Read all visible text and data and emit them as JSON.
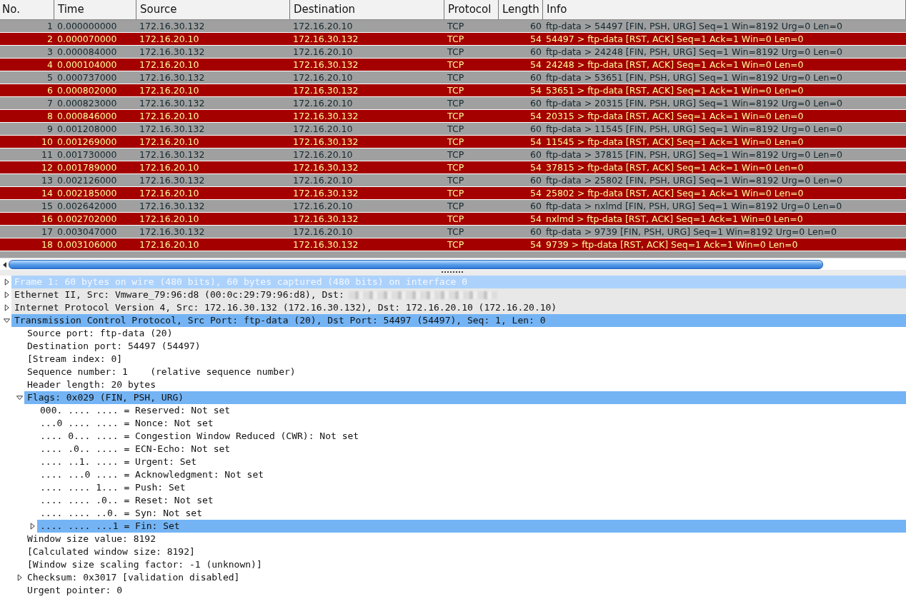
{
  "packet_list": {
    "columns": [
      "No.",
      "Time",
      "Source",
      "Destination",
      "Protocol",
      "Length",
      "Info"
    ],
    "rows": [
      {
        "kind": "normal",
        "cells": [
          "1",
          "0.000000000",
          "172.16.30.132",
          "172.16.20.10",
          "TCP",
          "60",
          "ftp-data > 54497 [FIN, PSH, URG] Seq=1 Win=8192 Urg=0 Len=0"
        ]
      },
      {
        "kind": "alert",
        "cells": [
          "2",
          "0.000070000",
          "172.16.20.10",
          "172.16.30.132",
          "TCP",
          "54",
          "54497 > ftp-data [RST, ACK] Seq=1 Ack=1 Win=0 Len=0"
        ]
      },
      {
        "kind": "normal",
        "cells": [
          "3",
          "0.000084000",
          "172.16.30.132",
          "172.16.20.10",
          "TCP",
          "60",
          "ftp-data > 24248 [FIN, PSH, URG] Seq=1 Win=8192 Urg=0 Len=0"
        ]
      },
      {
        "kind": "alert",
        "cells": [
          "4",
          "0.000104000",
          "172.16.20.10",
          "172.16.30.132",
          "TCP",
          "54",
          "24248 > ftp-data [RST, ACK] Seq=1 Ack=1 Win=0 Len=0"
        ]
      },
      {
        "kind": "normal",
        "cells": [
          "5",
          "0.000737000",
          "172.16.30.132",
          "172.16.20.10",
          "TCP",
          "60",
          "ftp-data > 53651 [FIN, PSH, URG] Seq=1 Win=8192 Urg=0 Len=0"
        ]
      },
      {
        "kind": "alert",
        "cells": [
          "6",
          "0.000802000",
          "172.16.20.10",
          "172.16.30.132",
          "TCP",
          "54",
          "53651 > ftp-data [RST, ACK] Seq=1 Ack=1 Win=0 Len=0"
        ]
      },
      {
        "kind": "normal",
        "cells": [
          "7",
          "0.000823000",
          "172.16.30.132",
          "172.16.20.10",
          "TCP",
          "60",
          "ftp-data > 20315 [FIN, PSH, URG] Seq=1 Win=8192 Urg=0 Len=0"
        ]
      },
      {
        "kind": "alert",
        "cells": [
          "8",
          "0.000846000",
          "172.16.20.10",
          "172.16.30.132",
          "TCP",
          "54",
          "20315 > ftp-data [RST, ACK] Seq=1 Ack=1 Win=0 Len=0"
        ]
      },
      {
        "kind": "normal",
        "cells": [
          "9",
          "0.001208000",
          "172.16.30.132",
          "172.16.20.10",
          "TCP",
          "60",
          "ftp-data > 11545 [FIN, PSH, URG] Seq=1 Win=8192 Urg=0 Len=0"
        ]
      },
      {
        "kind": "alert",
        "cells": [
          "10",
          "0.001269000",
          "172.16.20.10",
          "172.16.30.132",
          "TCP",
          "54",
          "11545 > ftp-data [RST, ACK] Seq=1 Ack=1 Win=0 Len=0"
        ]
      },
      {
        "kind": "normal",
        "cells": [
          "11",
          "0.001730000",
          "172.16.30.132",
          "172.16.20.10",
          "TCP",
          "60",
          "ftp-data > 37815 [FIN, PSH, URG] Seq=1 Win=8192 Urg=0 Len=0"
        ]
      },
      {
        "kind": "alert",
        "cells": [
          "12",
          "0.001789000",
          "172.16.20.10",
          "172.16.30.132",
          "TCP",
          "54",
          "37815 > ftp-data [RST, ACK] Seq=1 Ack=1 Win=0 Len=0"
        ]
      },
      {
        "kind": "normal",
        "cells": [
          "13",
          "0.002126000",
          "172.16.30.132",
          "172.16.20.10",
          "TCP",
          "60",
          "ftp-data > 25802 [FIN, PSH, URG] Seq=1 Win=8192 Urg=0 Len=0"
        ]
      },
      {
        "kind": "alert",
        "cells": [
          "14",
          "0.002185000",
          "172.16.20.10",
          "172.16.30.132",
          "TCP",
          "54",
          "25802 > ftp-data [RST, ACK] Seq=1 Ack=1 Win=0 Len=0"
        ]
      },
      {
        "kind": "normal",
        "cells": [
          "15",
          "0.002642000",
          "172.16.30.132",
          "172.16.20.10",
          "TCP",
          "60",
          "ftp-data > nxlmd [FIN, PSH, URG] Seq=1 Win=8192 Urg=0 Len=0"
        ]
      },
      {
        "kind": "alert",
        "cells": [
          "16",
          "0.002702000",
          "172.16.20.10",
          "172.16.30.132",
          "TCP",
          "54",
          "nxlmd > ftp-data [RST, ACK] Seq=1 Ack=1 Win=0 Len=0"
        ]
      },
      {
        "kind": "normal",
        "cells": [
          "17",
          "0.003047000",
          "172.16.30.132",
          "172.16.20.10",
          "TCP",
          "60",
          "ftp-data > 9739 [FIN, PSH, URG] Seq=1 Win=8192 Urg=0 Len=0"
        ]
      },
      {
        "kind": "alert",
        "cells": [
          "18",
          "0.003106000",
          "172.16.20.10",
          "172.16.30.132",
          "TCP",
          "54",
          "9739 > ftp-data [RST, ACK] Seq=1 Ack=1 Win=0 Len=0"
        ]
      }
    ]
  },
  "details_tree": {
    "nodes": [
      {
        "kind": "frame",
        "label": "Frame 1: 60 bytes on wire (480 bits), 60 bytes captured (480 bits) on interface 0",
        "expanded": false
      },
      {
        "kind": "protocol",
        "label": "Ethernet II, Src: Vmware_79:96:d8 (00:0c:29:79:96:d8), Dst:",
        "redacted": true,
        "expanded": false
      },
      {
        "kind": "protocol",
        "label": "Internet Protocol Version 4, Src: 172.16.30.132 (172.16.30.132), Dst: 172.16.20.10 (172.16.20.10)",
        "expanded": false
      },
      {
        "kind": "highlighted",
        "label": "Transmission Control Protocol, Src Port: ftp-data (20), Dst Port: 54497 (54497), Seq: 1, Len: 0",
        "expanded": true,
        "children": [
          {
            "kind": "field",
            "label": "Source port: ftp-data (20)"
          },
          {
            "kind": "field",
            "label": "Destination port: 54497 (54497)"
          },
          {
            "kind": "field",
            "label": "[Stream index: 0]"
          },
          {
            "kind": "field",
            "label": "Sequence number: 1    (relative sequence number)"
          },
          {
            "kind": "field",
            "label": "Header length: 20 bytes"
          },
          {
            "kind": "highlighted",
            "label": "Flags: 0x029 (FIN, PSH, URG)",
            "expanded": true,
            "children": [
              {
                "kind": "field",
                "label": "000. .... .... = Reserved: Not set"
              },
              {
                "kind": "field",
                "label": "...0 .... .... = Nonce: Not set"
              },
              {
                "kind": "field",
                "label": ".... 0... .... = Congestion Window Reduced (CWR): Not set"
              },
              {
                "kind": "field",
                "label": ".... .0.. .... = ECN-Echo: Not set"
              },
              {
                "kind": "field",
                "label": ".... ..1. .... = Urgent: Set"
              },
              {
                "kind": "field",
                "label": ".... ...0 .... = Acknowledgment: Not set"
              },
              {
                "kind": "field",
                "label": ".... .... 1... = Push: Set"
              },
              {
                "kind": "field",
                "label": ".... .... .0.. = Reset: Not set"
              },
              {
                "kind": "field",
                "label": ".... .... ..0. = Syn: Not set"
              },
              {
                "kind": "highlighted",
                "label": ".... .... ...1 = Fin: Set",
                "expanded": false
              }
            ]
          },
          {
            "kind": "field",
            "label": "Window size value: 8192"
          },
          {
            "kind": "field",
            "label": "[Calculated window size: 8192]"
          },
          {
            "kind": "field",
            "label": "[Window size scaling factor: -1 (unknown)]"
          },
          {
            "kind": "field",
            "label": "Checksum: 0x3017 [validation disabled]",
            "expanded": false
          },
          {
            "kind": "field",
            "label": "Urgent pointer: 0"
          }
        ]
      }
    ]
  }
}
